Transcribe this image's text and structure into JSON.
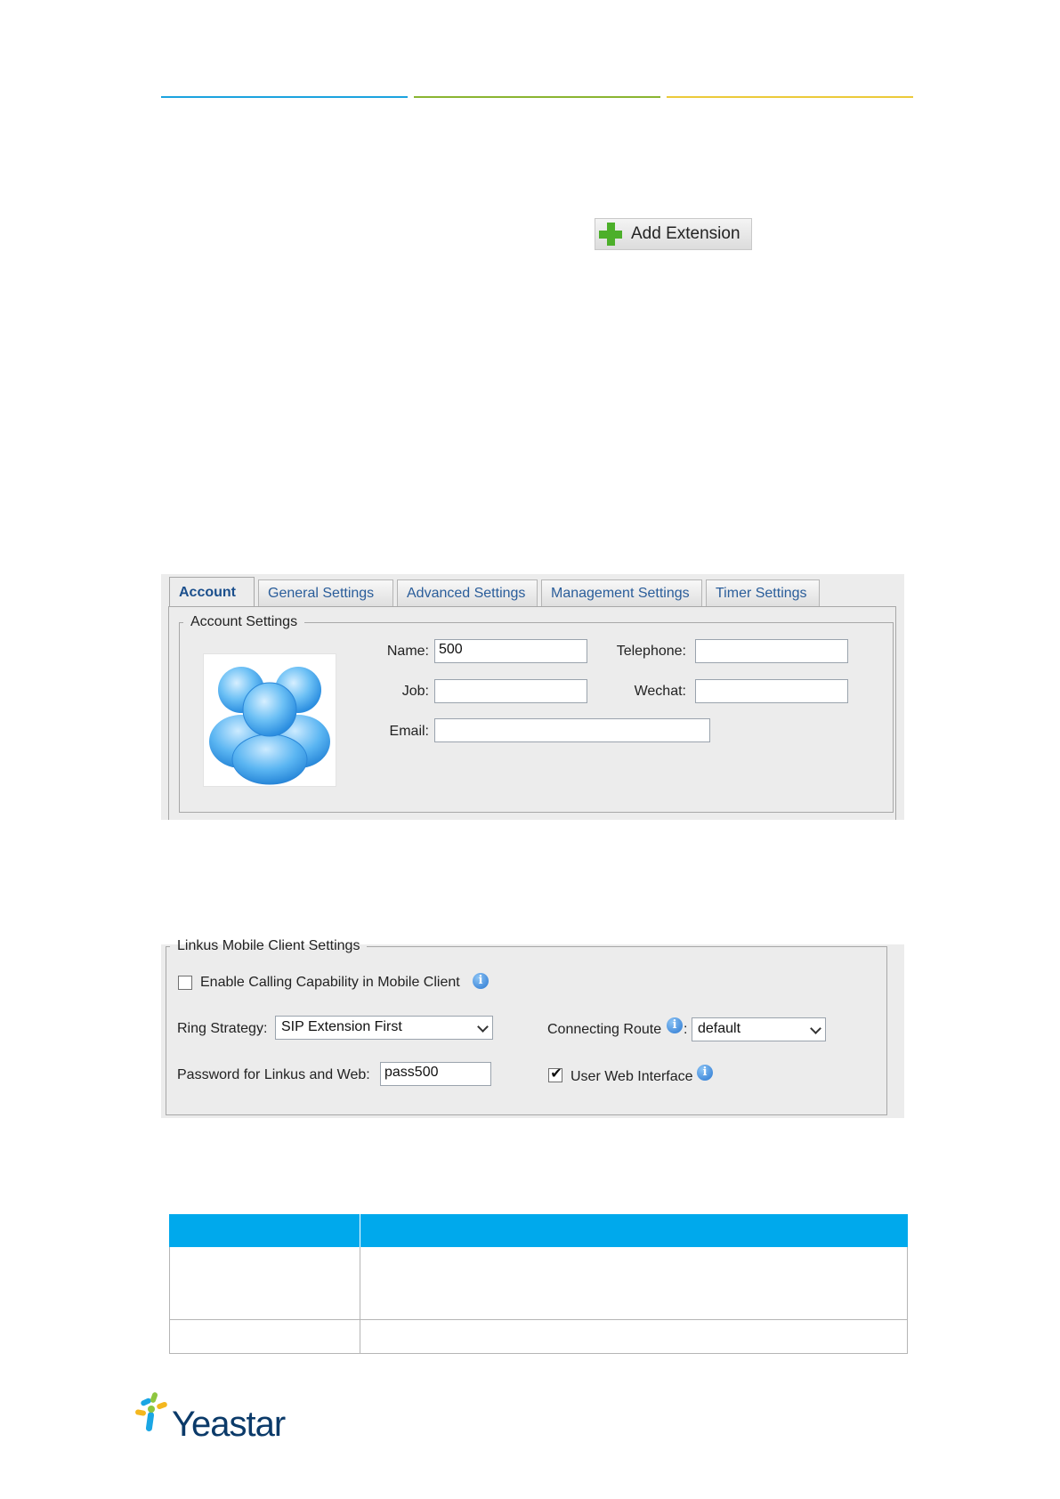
{
  "header": {
    "rule_colors": [
      "#1ba3df",
      "#8ab531",
      "#ecca3a"
    ]
  },
  "add_extension": {
    "label": "Add Extension",
    "icon": "plus-icon"
  },
  "account_panel": {
    "tabs": [
      {
        "label": "Account",
        "active": true
      },
      {
        "label": "General Settings",
        "active": false
      },
      {
        "label": "Advanced Settings",
        "active": false
      },
      {
        "label": "Management Settings",
        "active": false
      },
      {
        "label": "Timer Settings",
        "active": false
      }
    ],
    "section_title": "Account Settings",
    "avatar_icon": "user-group-icon",
    "fields": {
      "name": {
        "label": "Name:",
        "value": "500"
      },
      "telephone": {
        "label": "Telephone:",
        "value": ""
      },
      "job": {
        "label": "Job:",
        "value": ""
      },
      "wechat": {
        "label": "Wechat:",
        "value": ""
      },
      "email": {
        "label": "Email:",
        "value": ""
      }
    }
  },
  "linkus_panel": {
    "section_title": "Linkus Mobile Client Settings",
    "enable_calling": {
      "label": "Enable Calling Capability in Mobile Client",
      "checked": false
    },
    "ring_strategy": {
      "label": "Ring Strategy:",
      "value": "SIP Extension First"
    },
    "connecting_route": {
      "label": "Connecting Route",
      "colon": ":",
      "value": "default"
    },
    "password": {
      "label": "Password for Linkus and Web:",
      "value": "pass500"
    },
    "user_web_interface": {
      "label": "User Web Interface",
      "checked": true
    },
    "info_glyph": "i"
  },
  "table": {
    "header_color": "#00a9ec"
  },
  "footer": {
    "logo_text": "Yeastar",
    "logo_icon": "yeastar-logo-icon"
  }
}
